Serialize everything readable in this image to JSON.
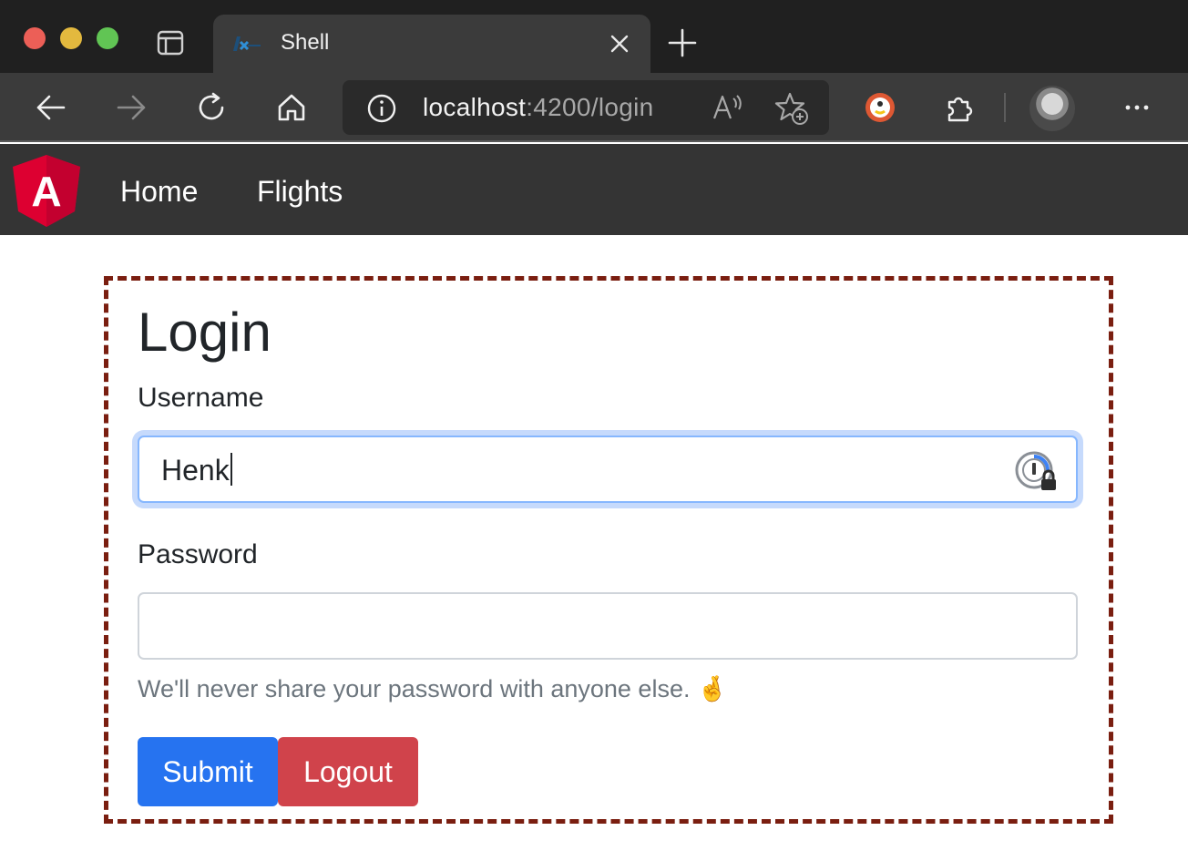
{
  "browser": {
    "tab": {
      "title": "Shell"
    },
    "address_bar": {
      "host": "localhost",
      "path": ":4200/login"
    }
  },
  "nav": {
    "logo": "angular-logo",
    "logo_letter": "A",
    "links": [
      {
        "label": "Home"
      },
      {
        "label": "Flights"
      }
    ]
  },
  "login": {
    "title": "Login",
    "username": {
      "label": "Username",
      "value": "Henk"
    },
    "password": {
      "label": "Password",
      "value": ""
    },
    "help_text": "We'll never share your password with anyone else.",
    "help_emoji": "🤞",
    "buttons": {
      "submit": "Submit",
      "logout": "Logout"
    }
  },
  "colors": {
    "card_border": "#7a1e10",
    "submit_bg": "#2673f0",
    "logout_bg": "#d0434b",
    "nav_bg": "#343434",
    "angular_red": "#dd0031"
  }
}
